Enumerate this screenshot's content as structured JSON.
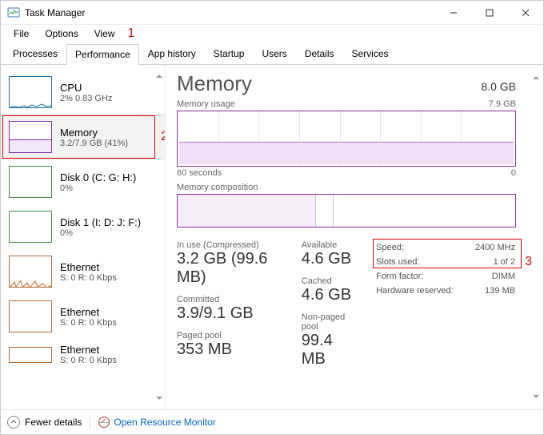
{
  "window": {
    "title": "Task Manager"
  },
  "menubar": [
    "File",
    "Options",
    "View"
  ],
  "tabs": [
    "Processes",
    "Performance",
    "App history",
    "Startup",
    "Users",
    "Details",
    "Services"
  ],
  "active_tab": 1,
  "annotations": {
    "one": "1",
    "two": "2",
    "three": "3"
  },
  "sidebar": [
    {
      "title": "CPU",
      "sub": "2% 0.83 GHz",
      "type": "cpu"
    },
    {
      "title": "Memory",
      "sub": "3.2/7.9 GB (41%)",
      "type": "mem",
      "selected": true
    },
    {
      "title": "Disk 0 (C: G: H:)",
      "sub": "0%",
      "type": "disk"
    },
    {
      "title": "Disk 1 (I: D: J: F:)",
      "sub": "0%",
      "type": "disk"
    },
    {
      "title": "Ethernet",
      "sub": "S: 0  R: 0 Kbps",
      "type": "eth"
    },
    {
      "title": "Ethernet",
      "sub": "S: 0  R: 0 Kbps",
      "type": "eth"
    },
    {
      "title": "Ethernet",
      "sub": "S: 0  R: 0 Kbps",
      "type": "eth"
    }
  ],
  "panel": {
    "heading": "Memory",
    "total": "8.0 GB",
    "usage_label": "Memory usage",
    "usage_right": "7.9 GB",
    "axis_left": "60 seconds",
    "axis_right": "0",
    "comp_label": "Memory composition",
    "stats_left": [
      {
        "lbl": "In use (Compressed)",
        "val": "3.2 GB (99.6 MB)"
      },
      {
        "lbl": "Committed",
        "val": "3.9/9.1 GB"
      },
      {
        "lbl": "Paged pool",
        "val": "353 MB"
      }
    ],
    "stats_mid": [
      {
        "lbl": "Available",
        "val": "4.6 GB"
      },
      {
        "lbl": "Cached",
        "val": "4.6 GB"
      },
      {
        "lbl": "Non-paged pool",
        "val": "99.4 MB"
      }
    ],
    "side_stats": [
      {
        "k": "Speed:",
        "v": "2400 MHz"
      },
      {
        "k": "Slots used:",
        "v": "1 of 2"
      },
      {
        "k": "Form factor:",
        "v": "DIMM"
      },
      {
        "k": "Hardware reserved:",
        "v": "139 MB"
      }
    ]
  },
  "footer": {
    "fewer": "Fewer details",
    "orm": "Open Resource Monitor"
  },
  "chart_data": {
    "type": "area",
    "title": "Memory usage",
    "ylabel": "GB",
    "ylim": [
      0,
      7.9
    ],
    "x_range_seconds": 60,
    "series": [
      {
        "name": "In use",
        "approx_value_gb": 3.2
      }
    ],
    "composition_segments": [
      {
        "name": "In use",
        "fraction": 0.41
      },
      {
        "name": "Modified/Standby",
        "fraction": 0.05
      },
      {
        "name": "Free",
        "fraction": 0.54
      }
    ]
  }
}
